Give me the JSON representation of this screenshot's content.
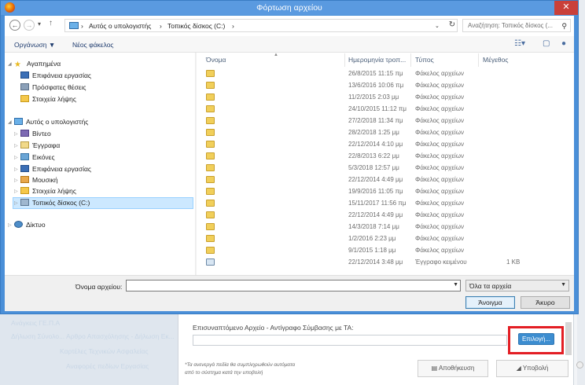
{
  "dialog": {
    "title": "Φόρτωση αρχείου",
    "close_glyph": "✕"
  },
  "address": {
    "crumbs": [
      "Αυτός ο υπολογιστής",
      "Τοπικός δίσκος (C:)"
    ],
    "search_placeholder": "Αναζήτηση: Τοπικός δίσκος (..."
  },
  "toolbar": {
    "organize": "Οργάνωση ▼",
    "new_folder": "Νέος φάκελος"
  },
  "nav": {
    "favorites": "Αγαπημένα",
    "fav_items": [
      "Επιφάνεια εργασίας",
      "Πρόσφατες θέσεις",
      "Στοιχεία λήψης"
    ],
    "this_pc": "Αυτός ο υπολογιστής",
    "pc_items": [
      "Βίντεο",
      "Έγγραφα",
      "Εικόνες",
      "Επιφάνεια εργασίας",
      "Μουσική",
      "Στοιχεία λήψης",
      "Τοπικός δίσκος (C:)"
    ],
    "network": "Δίκτυο"
  },
  "list": {
    "headers": {
      "name": "Όνομα",
      "date": "Ημερομηνία τροπ...",
      "type": "Τύπος",
      "size": "Μέγεθος"
    },
    "rows": [
      {
        "name": "",
        "date": "26/8/2015 11:15 πμ",
        "type": "Φάκελος αρχείων",
        "size": "",
        "kind": "folder"
      },
      {
        "name": "",
        "date": "13/6/2016 10:06 πμ",
        "type": "Φάκελος αρχείων",
        "size": "",
        "kind": "folder"
      },
      {
        "name": "",
        "date": "11/2/2015 2:03 μμ",
        "type": "Φάκελος αρχείων",
        "size": "",
        "kind": "folder"
      },
      {
        "name": "",
        "date": "24/10/2015 11:12 πμ",
        "type": "Φάκελος αρχείων",
        "size": "",
        "kind": "folder"
      },
      {
        "name": "",
        "date": "27/2/2018 11:34 πμ",
        "type": "Φάκελος αρχείων",
        "size": "",
        "kind": "folder"
      },
      {
        "name": "",
        "date": "28/2/2018 1:25 μμ",
        "type": "Φάκελος αρχείων",
        "size": "",
        "kind": "folder"
      },
      {
        "name": "",
        "date": "22/12/2014 4:10 μμ",
        "type": "Φάκελος αρχείων",
        "size": "",
        "kind": "folder"
      },
      {
        "name": "",
        "date": "22/8/2013 6:22 μμ",
        "type": "Φάκελος αρχείων",
        "size": "",
        "kind": "folder"
      },
      {
        "name": "",
        "date": "5/3/2018 12:57 μμ",
        "type": "Φάκελος αρχείων",
        "size": "",
        "kind": "folder"
      },
      {
        "name": "",
        "date": "22/12/2014 4:49 μμ",
        "type": "Φάκελος αρχείων",
        "size": "",
        "kind": "folder"
      },
      {
        "name": "",
        "date": "19/9/2016 11:05 πμ",
        "type": "Φάκελος αρχείων",
        "size": "",
        "kind": "folder"
      },
      {
        "name": "",
        "date": "15/11/2017 11:56 πμ",
        "type": "Φάκελος αρχείων",
        "size": "",
        "kind": "folder"
      },
      {
        "name": "",
        "date": "22/12/2014 4:49 μμ",
        "type": "Φάκελος αρχείων",
        "size": "",
        "kind": "folder"
      },
      {
        "name": "",
        "date": "14/3/2018 7:14 μμ",
        "type": "Φάκελος αρχείων",
        "size": "",
        "kind": "folder"
      },
      {
        "name": "",
        "date": "1/2/2016 2:23 μμ",
        "type": "Φάκελος αρχείων",
        "size": "",
        "kind": "folder"
      },
      {
        "name": "",
        "date": "9/1/2015 1:18 μμ",
        "type": "Φάκελος αρχείων",
        "size": "",
        "kind": "folder"
      },
      {
        "name": "",
        "date": "22/12/2014 3:48 μμ",
        "type": "Έγγραφο κειμένου",
        "size": "1 KB",
        "kind": "text"
      }
    ]
  },
  "bottom": {
    "filename_label": "Όνομα αρχείου:",
    "filename_value": "",
    "filetype": "Όλα τα αρχεία",
    "open": "Άνοιγμα",
    "cancel": "Άκυρο"
  },
  "form": {
    "attachment_label": "Επισυναπτόμενο Αρχείο - Αντίγραφο Σύμβασης με ΤΑ:",
    "choose": "Επιλογή...",
    "note_line1": "*Τα ανενεργά πεδία θα συμπληρωθούν αυτόματα",
    "note_line2": "από το σύστημα κατά την υποβολή",
    "save": "Αποθήκευση",
    "submit": "Υποβολή"
  },
  "background": {
    "left_lines": [
      "Ανάγκεις ΓΕ.Π.Α",
      "Δήλωση Σύνολο... Αρθρο Απασχόλησης - Δήλωση Εκ...",
      "Καρτέλες Τεχνικών Ασφαλείας",
      "Αναφορές πεδίων Εργασίας"
    ]
  },
  "colors": {
    "title_bar": "#5a9ae0",
    "close_red": "#c9403a",
    "highlight_red": "#e31e24",
    "choose_blue": "#3c8dd0"
  }
}
